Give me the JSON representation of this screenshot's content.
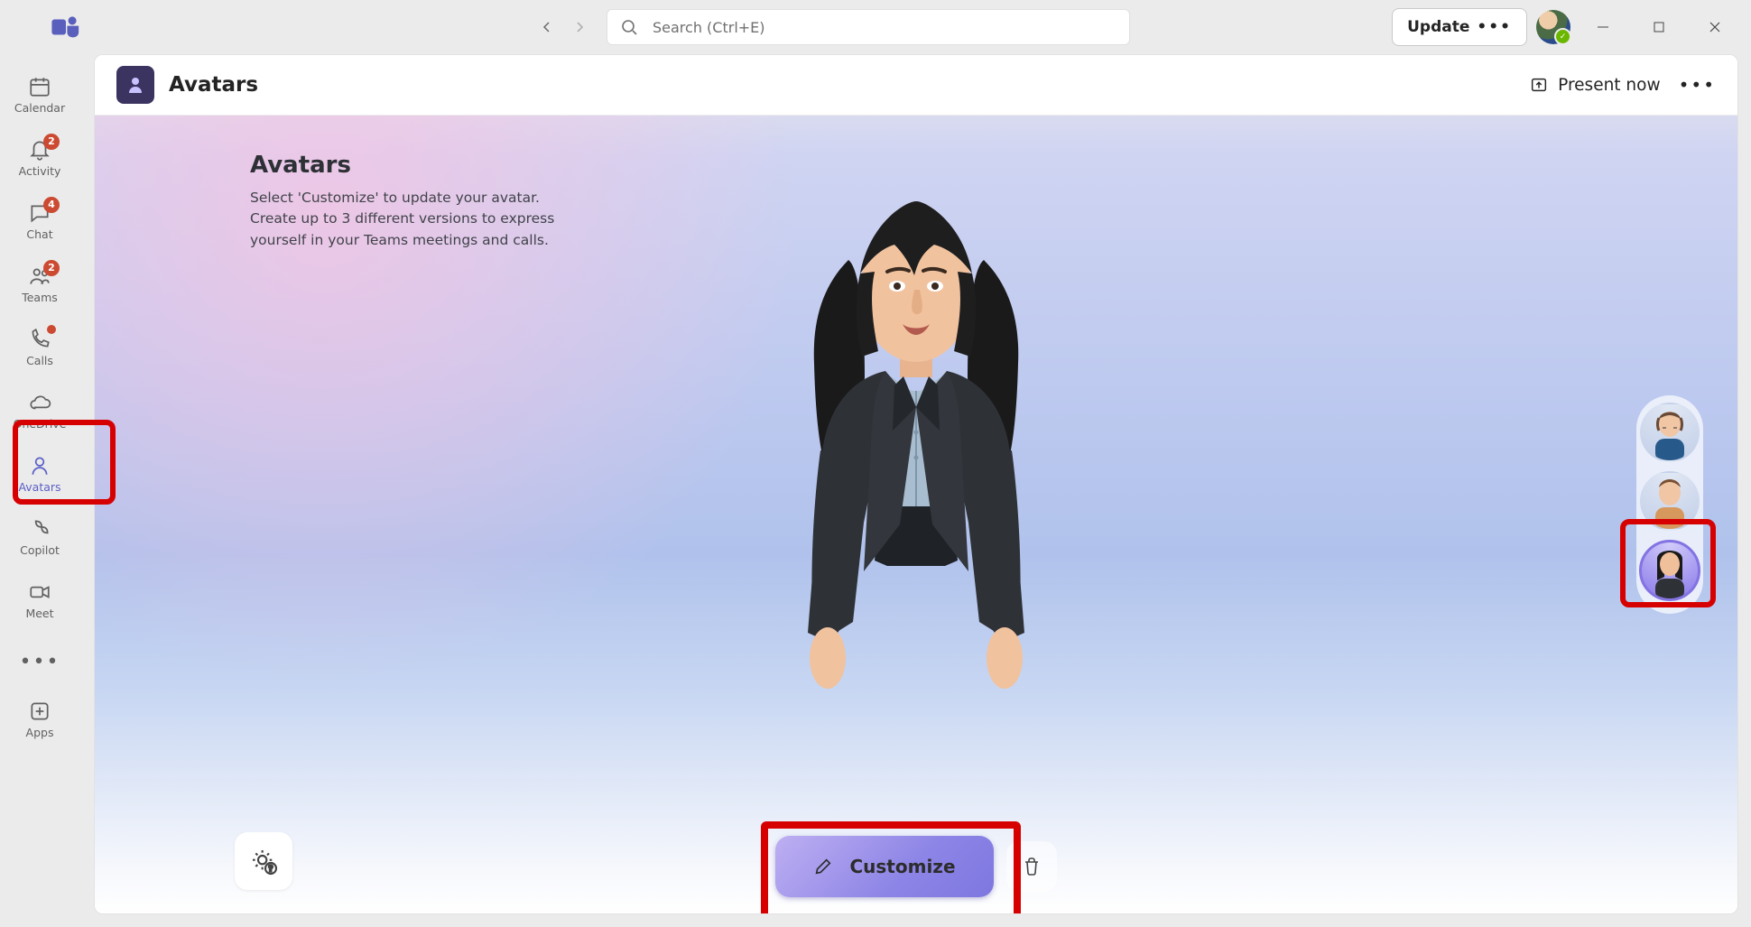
{
  "search": {
    "placeholder": "Search (Ctrl+E)"
  },
  "update_label": "Update",
  "rail": {
    "items": [
      {
        "label": "Calendar"
      },
      {
        "label": "Activity",
        "badge": "2"
      },
      {
        "label": "Chat",
        "badge": "4"
      },
      {
        "label": "Teams",
        "badge": "2"
      },
      {
        "label": "Calls",
        "dot": true
      },
      {
        "label": "OneDrive"
      },
      {
        "label": "Avatars",
        "active": true
      },
      {
        "label": "Copilot"
      },
      {
        "label": "Meet"
      }
    ],
    "apps_label": "Apps"
  },
  "page": {
    "title": "Avatars",
    "present_label": "Present now"
  },
  "intro": {
    "title": "Avatars",
    "body": "Select 'Customize' to update your avatar. Create up to 3 different versions to express yourself in your Teams meetings and calls."
  },
  "actions": {
    "customize": "Customize"
  },
  "variants": {
    "count": 3,
    "selected_index": 2
  }
}
